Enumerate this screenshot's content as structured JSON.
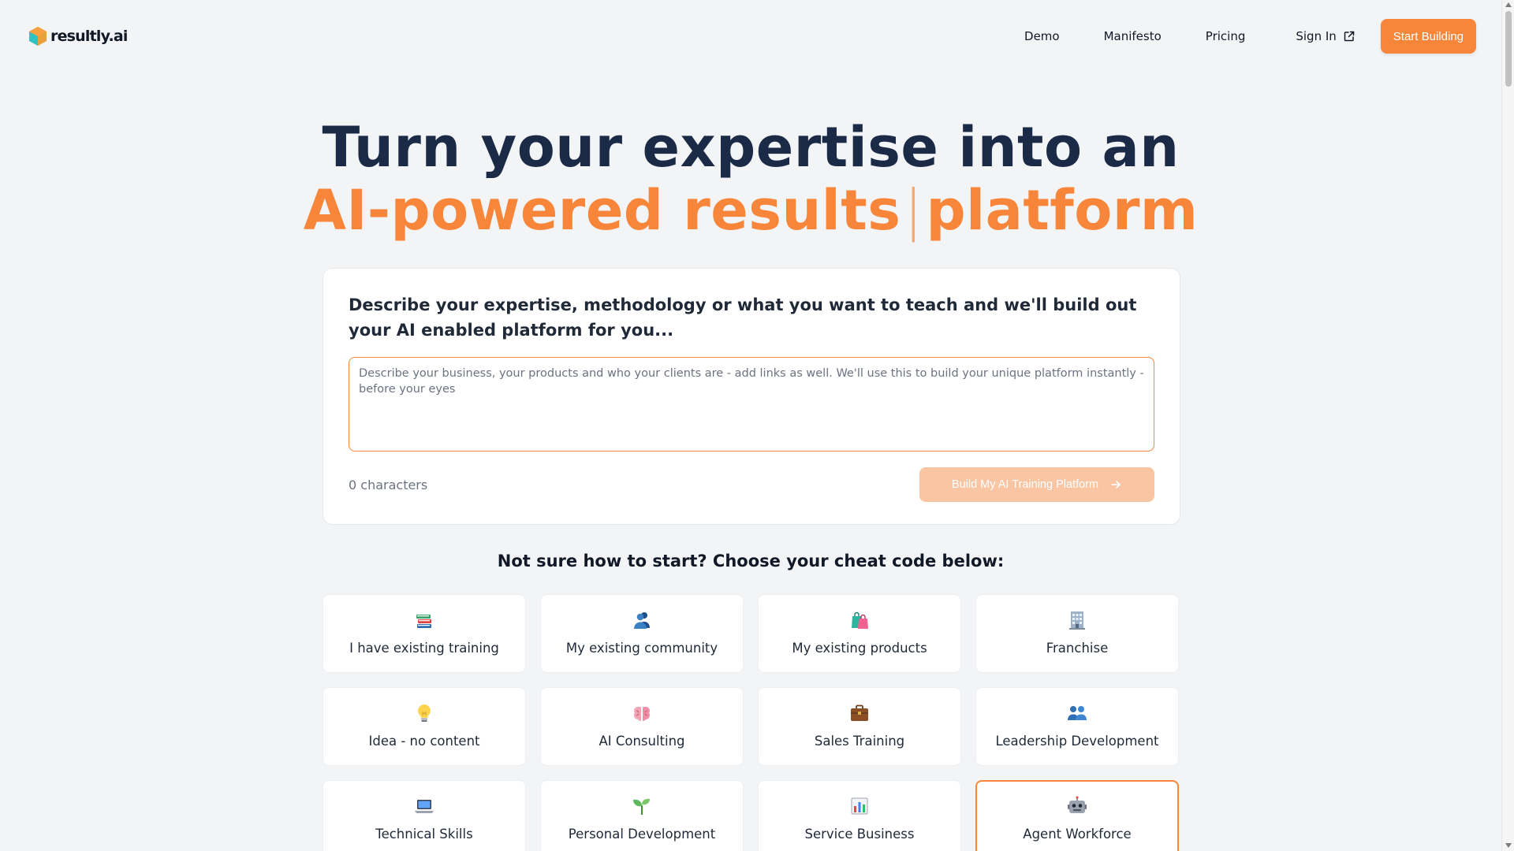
{
  "brand": {
    "name": "resultly.ai",
    "accent": "#f7853a",
    "dark": "#1b2a47"
  },
  "nav": {
    "links": [
      "Demo",
      "Manifesto",
      "Pricing"
    ],
    "sign_in": "Sign In",
    "cta": "Start Building"
  },
  "hero": {
    "line1": "Turn your expertise into an",
    "line2_a": "AI-powered results",
    "line2_cursor": "|",
    "line2_b": "platform"
  },
  "builder": {
    "title": "Describe your expertise, methodology or what you want to teach and we'll build out your AI enabled platform for you...",
    "placeholder": "Describe your business, your products and who your clients are - add links as well. We'll use this to build your unique platform instantly - before your eyes",
    "value": "",
    "char_count": "0 characters",
    "button": "Build My AI Training Platform"
  },
  "cheat_codes": {
    "title": "Not sure how to start? Choose your cheat code below:",
    "items": [
      {
        "label": "I have existing training",
        "icon": "books-icon"
      },
      {
        "label": "My existing community",
        "icon": "people-icon"
      },
      {
        "label": "My existing products",
        "icon": "shopping-bags-icon"
      },
      {
        "label": "Franchise",
        "icon": "office-building-icon"
      },
      {
        "label": "Idea - no content",
        "icon": "lightbulb-icon"
      },
      {
        "label": "AI Consulting",
        "icon": "brain-icon"
      },
      {
        "label": "Sales Training",
        "icon": "briefcase-icon"
      },
      {
        "label": "Leadership Development",
        "icon": "group-icon"
      },
      {
        "label": "Technical Skills",
        "icon": "laptop-icon"
      },
      {
        "label": "Personal Development",
        "icon": "seedling-icon"
      },
      {
        "label": "Service Business",
        "icon": "bar-chart-icon"
      },
      {
        "label": "Agent Workforce",
        "icon": "robot-icon",
        "selected": true
      }
    ]
  }
}
